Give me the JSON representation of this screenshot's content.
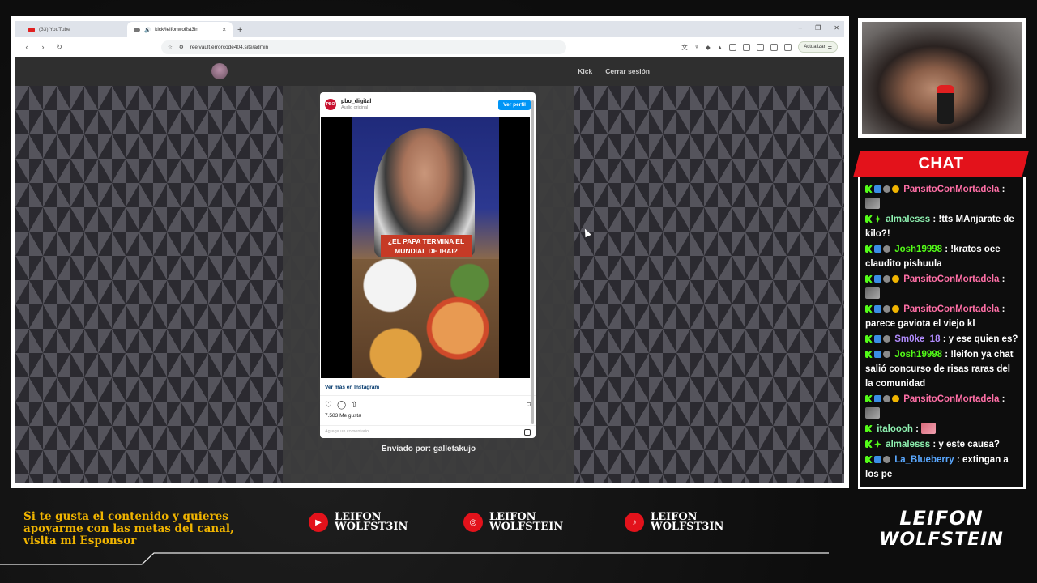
{
  "browser": {
    "tabs": [
      {
        "label": "(33) YouTube",
        "active": false
      },
      {
        "label": "kick/leifonwolfst3in",
        "active": true
      }
    ],
    "new_tab": "+",
    "url": "reelvault.errorcode404.site/admin",
    "update_label": "Actualizar"
  },
  "site": {
    "nav": {
      "kick": "Kick",
      "logout": "Cerrar sesión"
    },
    "sent_by": "Enviado por: galletakujo"
  },
  "instagram": {
    "avatar_text": "PBO",
    "username": "pbo_digital",
    "audio": "Audio original",
    "follow": "Ver perfil",
    "video_caption": "¿EL PAPA TERMINA EL MUNDIAL DE IBAI?",
    "view_more": "Ver más en Instagram",
    "likes": "7.583 Me gusta",
    "comment_placeholder": "Agrega un comentario..."
  },
  "chat": {
    "title": "CHAT",
    "messages": [
      {
        "user": "PansitoConMortadela",
        "color": "#ff6fa6",
        "text": ":"
      },
      {
        "user": "almalesss",
        "color": "#8ef0b0",
        "text": ": !tts MAnjarate de kilo?!"
      },
      {
        "user": "Josh19998",
        "color": "#53fc18",
        "text": ": !kratos oee claudito pishuula"
      },
      {
        "user": "PansitoConMortadela",
        "color": "#ff6fa6",
        "text": ":"
      },
      {
        "user": "PansitoConMortadela",
        "color": "#ff6fa6",
        "text": ": parece gaviota el viejo kl"
      },
      {
        "user": "Sm0ke_18",
        "color": "#b28cff",
        "text": ": y ese quien es?"
      },
      {
        "user": "Josh19998",
        "color": "#53fc18",
        "text": ": !leifon ya chat salió concurso de risas raras del la comunidad"
      },
      {
        "user": "PansitoConMortadela",
        "color": "#ff6fa6",
        "text": ":"
      },
      {
        "user": "italoooh",
        "color": "#8ef0b0",
        "text": ":"
      },
      {
        "user": "almalesss",
        "color": "#8ef0b0",
        "text": ": y este causa?"
      },
      {
        "user": "La_Blueberry",
        "color": "#5aa8ff",
        "text": ": extingan a los pe"
      }
    ]
  },
  "footer": {
    "sponsor_text": "Si te gusta el contenido y quieres apoyarme con las metas del canal, visita mi Esponsor",
    "socials": [
      {
        "icon": "youtube-icon",
        "line1": "LEIFON",
        "line2": "WOLFST3IN"
      },
      {
        "icon": "instagram-icon",
        "line1": "LEIFON",
        "line2": "WOLFSTEIN"
      },
      {
        "icon": "tiktok-icon",
        "line1": "LEIFON",
        "line2": "WOLFST3IN"
      }
    ],
    "logo_line1": "LEIFON",
    "logo_line2": "WOLFSTEIN"
  },
  "colors": {
    "accent_red": "#e3121b",
    "sponsor_gold": "#f0b400",
    "kick_green": "#53fc18"
  }
}
